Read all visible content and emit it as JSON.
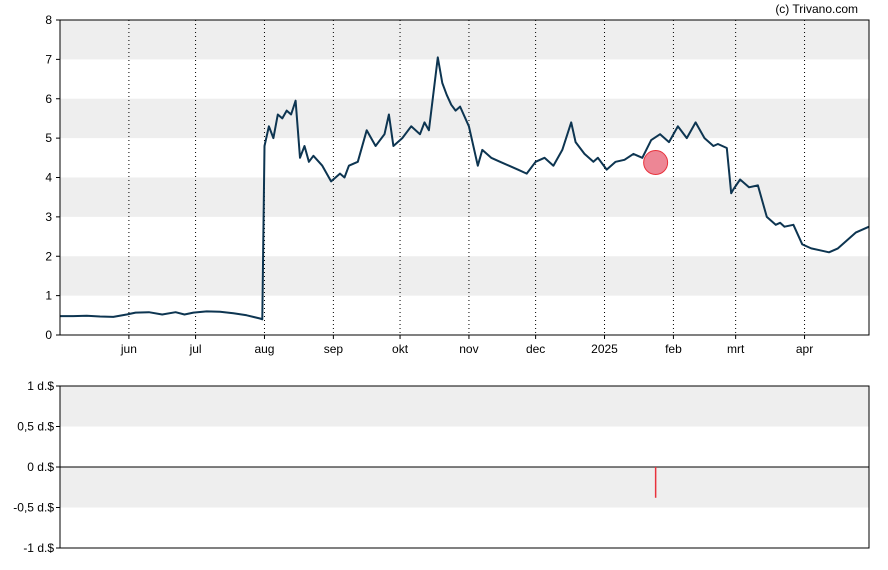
{
  "copyright": "(c) Trivano.com",
  "colors": {
    "line": "#0d3551",
    "band": "#eeeeee",
    "marker": "#e8687a",
    "volume_bar": "#e8323c",
    "grid": "#000000"
  },
  "chart_data": [
    {
      "type": "line",
      "title": "",
      "xlabel": "",
      "ylabel": "",
      "ylim": [
        0,
        8
      ],
      "y_ticks": [
        "0",
        "1",
        "2",
        "3",
        "4",
        "5",
        "6",
        "7",
        "8"
      ],
      "x_ticks": [
        {
          "label": "jun",
          "day": 31
        },
        {
          "label": "jul",
          "day": 61
        },
        {
          "label": "aug",
          "day": 92
        },
        {
          "label": "sep",
          "day": 123
        },
        {
          "label": "okt",
          "day": 153
        },
        {
          "label": "nov",
          "day": 184
        },
        {
          "label": "dec",
          "day": 214
        },
        {
          "label": "2025",
          "day": 245
        },
        {
          "label": "feb",
          "day": 276
        },
        {
          "label": "mrt",
          "day": 304
        },
        {
          "label": "apr",
          "day": 335
        }
      ],
      "x_range_days": [
        0,
        364
      ],
      "grid": "vertical dotted at month ticks, alternating horizontal bands",
      "x": [
        0,
        6,
        12,
        18,
        24,
        30,
        34,
        40,
        46,
        52,
        56,
        60,
        66,
        72,
        78,
        84,
        90,
        91,
        92,
        94,
        96,
        98,
        100,
        102,
        104,
        106,
        108,
        110,
        112,
        114,
        118,
        122,
        126,
        128,
        130,
        134,
        138,
        142,
        146,
        148,
        150,
        154,
        158,
        162,
        164,
        166,
        170,
        172,
        174,
        176,
        178,
        180,
        184,
        188,
        190,
        194,
        198,
        202,
        206,
        210,
        214,
        218,
        222,
        226,
        230,
        232,
        236,
        240,
        242,
        246,
        250,
        254,
        258,
        262,
        266,
        270,
        274,
        278,
        282,
        286,
        290,
        294,
        296,
        300,
        302,
        303,
        306,
        310,
        314,
        318,
        322,
        324,
        326,
        330,
        334,
        338,
        342,
        346,
        350,
        354,
        358,
        364
      ],
      "y": [
        0.48,
        0.48,
        0.49,
        0.47,
        0.46,
        0.52,
        0.57,
        0.58,
        0.52,
        0.58,
        0.52,
        0.57,
        0.6,
        0.59,
        0.55,
        0.5,
        0.42,
        0.4,
        4.8,
        5.3,
        5.0,
        5.6,
        5.5,
        5.7,
        5.6,
        5.95,
        4.5,
        4.8,
        4.4,
        4.55,
        4.3,
        3.9,
        4.1,
        4.0,
        4.3,
        4.4,
        5.2,
        4.8,
        5.1,
        5.6,
        4.8,
        5.0,
        5.3,
        5.1,
        5.4,
        5.2,
        7.05,
        6.4,
        6.1,
        5.85,
        5.7,
        5.8,
        5.3,
        4.3,
        4.7,
        4.5,
        4.4,
        4.3,
        4.2,
        4.1,
        4.4,
        4.5,
        4.3,
        4.7,
        5.4,
        4.9,
        4.6,
        4.4,
        4.5,
        4.2,
        4.4,
        4.45,
        4.6,
        4.5,
        4.95,
        5.1,
        4.9,
        5.3,
        5.0,
        5.4,
        5.0,
        4.8,
        4.85,
        4.75,
        3.6,
        3.7,
        3.95,
        3.75,
        3.8,
        3.0,
        2.8,
        2.85,
        2.75,
        2.8,
        2.3,
        2.2,
        2.15,
        2.1,
        2.2,
        2.4,
        2.6,
        2.75
      ],
      "marker": {
        "day": 268,
        "value": 4.38
      }
    },
    {
      "type": "bar",
      "title": "",
      "xlabel": "",
      "ylabel": "",
      "ylim": [
        -1,
        1
      ],
      "y_ticks": [
        "1 d.$",
        "0,5 d.$",
        "0 d.$",
        "-0,5 d.$",
        "-1 d.$"
      ],
      "bars": [
        {
          "day": 268,
          "value": -0.38
        }
      ]
    }
  ]
}
